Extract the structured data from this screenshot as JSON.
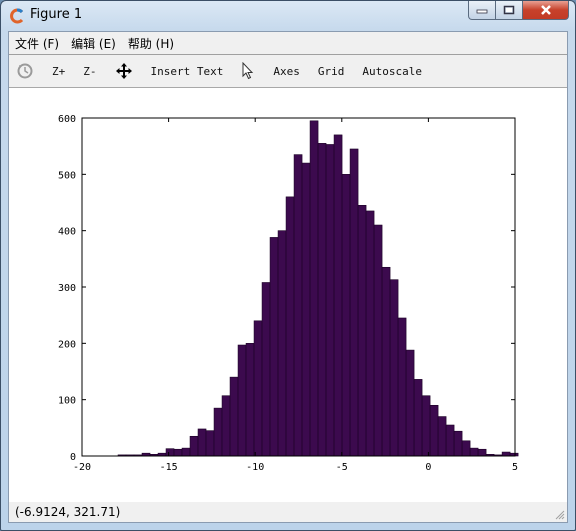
{
  "window": {
    "title": "Figure 1",
    "controls": {
      "minimize": "minimize",
      "maximize": "maximize",
      "close": "close"
    }
  },
  "menu": {
    "items": [
      {
        "label": "文件 (F)"
      },
      {
        "label": "编辑 (E)"
      },
      {
        "label": "帮助 (H)"
      }
    ]
  },
  "toolbar": {
    "rotate_icon": "rotate-icon",
    "zoom_in_label": "Z+",
    "zoom_out_label": "Z-",
    "pan_icon": "pan-arrows-icon",
    "insert_text_label": "Insert Text",
    "select_icon": "pointer-icon",
    "axes_label": "Axes",
    "grid_label": "Grid",
    "autoscale_label": "Autoscale"
  },
  "status": {
    "coordinates": "(-6.9124, 321.71)"
  },
  "colors": {
    "bar_fill": "#3c0a4e",
    "bar_edge": "#1a0024"
  },
  "chart_data": {
    "type": "bar",
    "title": "",
    "xlabel": "",
    "ylabel": "",
    "xlim": [
      -20,
      5
    ],
    "ylim": [
      0,
      600
    ],
    "xticks": [
      -20,
      -15,
      -10,
      -5,
      0,
      5
    ],
    "yticks": [
      0,
      100,
      200,
      300,
      400,
      500,
      600
    ],
    "xtick_labels": [
      "-20",
      "-15",
      "-10",
      "-5",
      "0",
      "5"
    ],
    "ytick_labels": [
      "0",
      "100",
      "200",
      "300",
      "400",
      "500",
      "600"
    ],
    "grid": false,
    "bin_start": -17.92,
    "bin_width": 0.462,
    "values": [
      2,
      2,
      2,
      5,
      3,
      5,
      13,
      12,
      14,
      35,
      48,
      45,
      85,
      107,
      140,
      197,
      200,
      240,
      308,
      388,
      400,
      460,
      535,
      520,
      595,
      555,
      553,
      570,
      500,
      545,
      445,
      435,
      410,
      335,
      313,
      245,
      188,
      136,
      107,
      90,
      70,
      55,
      44,
      27,
      14,
      12,
      3,
      2,
      7,
      5
    ]
  }
}
